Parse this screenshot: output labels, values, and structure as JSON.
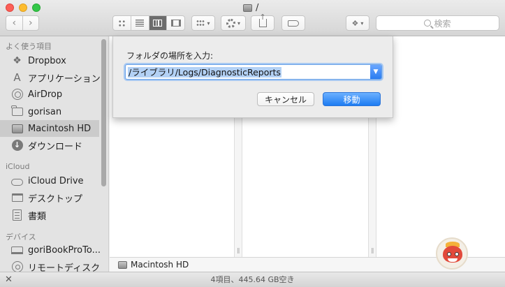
{
  "window": {
    "title": "/"
  },
  "search": {
    "placeholder": "検索"
  },
  "sidebar": {
    "sections": [
      {
        "header": "よく使う項目",
        "items": [
          {
            "label": "Dropbox",
            "icon": "dropbox-icon"
          },
          {
            "label": "アプリケーション",
            "icon": "applications-icon"
          },
          {
            "label": "AirDrop",
            "icon": "airdrop-icon"
          },
          {
            "label": "gorisan",
            "icon": "folder-icon"
          },
          {
            "label": "Macintosh HD",
            "icon": "hard-drive-icon",
            "selected": true
          },
          {
            "label": "ダウンロード",
            "icon": "download-icon"
          }
        ]
      },
      {
        "header": "iCloud",
        "items": [
          {
            "label": "iCloud Drive",
            "icon": "cloud-icon"
          },
          {
            "label": "デスクトップ",
            "icon": "desktop-icon"
          },
          {
            "label": "書類",
            "icon": "documents-icon"
          }
        ]
      },
      {
        "header": "デバイス",
        "items": [
          {
            "label": "goriBookProTo...",
            "icon": "laptop-icon"
          },
          {
            "label": "リモートディスク",
            "icon": "remote-disc-icon"
          }
        ]
      }
    ]
  },
  "dialog": {
    "label": "フォルダの場所を入力:",
    "value": "/ライブラリ/Logs/DiagnosticReports",
    "cancel_label": "キャンセル",
    "go_label": "移動"
  },
  "pathbar": {
    "item": "Macintosh HD"
  },
  "status": {
    "text": "4項目、445.64 GB空き"
  },
  "colors": {
    "accent": "#2a7df0",
    "selection": "#b3d1f5",
    "sidebar_selected": "#cbcbcb"
  }
}
